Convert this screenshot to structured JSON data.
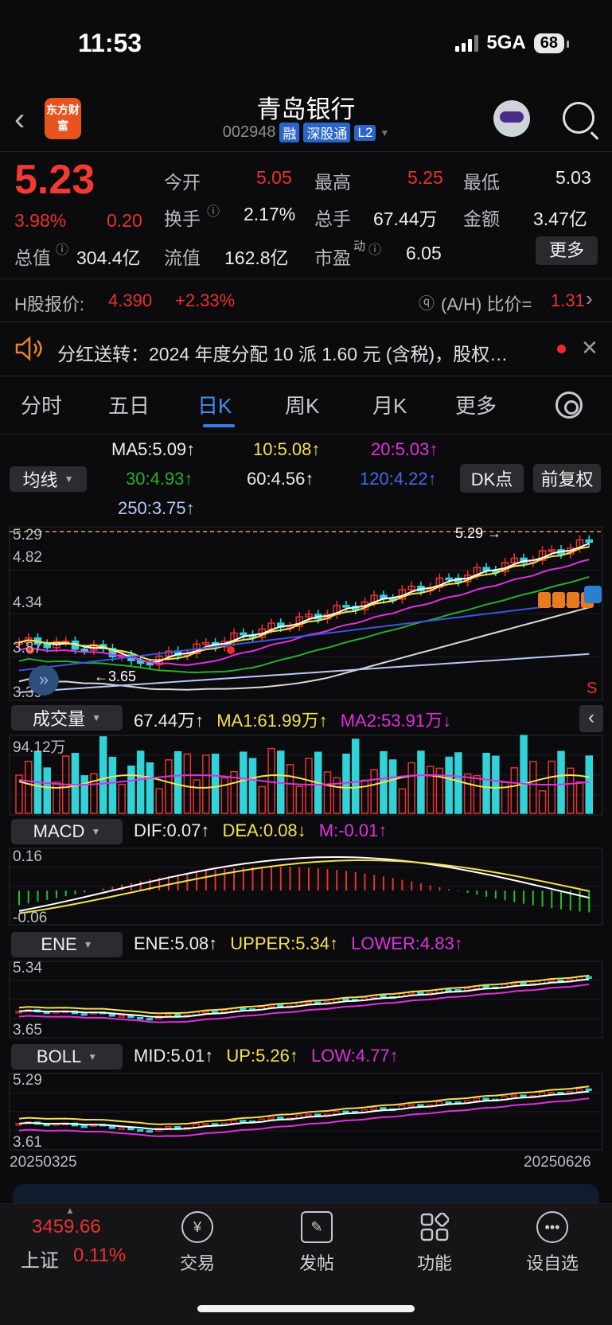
{
  "status": {
    "time": "11:53",
    "network": "5GA",
    "battery": "68"
  },
  "header": {
    "logo_text": "东方财富",
    "stock_name": "青岛银行",
    "stock_code": "002948",
    "tags": [
      "融",
      "深股通",
      "L2"
    ]
  },
  "quote": {
    "price": "5.23",
    "change_pct": "3.98%",
    "change": "0.20",
    "open_label": "今开",
    "open": "5.05",
    "high_label": "最高",
    "high": "5.25",
    "low_label": "最低",
    "low": "5.03",
    "turnover_label": "换手",
    "turnover": "2.17%",
    "volume_label": "总手",
    "volume": "67.44万",
    "amount_label": "金额",
    "amount": "3.47亿",
    "mktcap_label": "总值",
    "mktcap": "304.4亿",
    "float_label": "流值",
    "float": "162.8亿",
    "pe_label": "市盈",
    "pe_sup": "动",
    "pe": "6.05",
    "more": "更多"
  },
  "hshare": {
    "label": "H股报价:",
    "price": "4.390",
    "change": "+2.33%",
    "ratio_label": "(A/H) 比价=",
    "ratio": "1.31"
  },
  "notice": {
    "text": "分红送转：2024 年度分配 10 派 1.60 元 (含税)，股权…"
  },
  "tabs": [
    "分时",
    "五日",
    "日K",
    "周K",
    "月K",
    "更多"
  ],
  "active_tab": 2,
  "ma": {
    "selector": "均线",
    "ma5": "MA5:5.09",
    "ma10": "10:5.08",
    "ma20": "20:5.03",
    "ma30": "30:4.93",
    "ma60": "60:4.56",
    "ma120": "120:4.22",
    "ma250": "250:3.75",
    "dk": "DK点",
    "adjust": "前复权"
  },
  "kline": {
    "y_labels": [
      "5.29",
      "4.82",
      "4.34",
      "3.87",
      "3.39"
    ],
    "hi_mark": "5.29",
    "lo_mark": "3.65",
    "signal": "S"
  },
  "volume_panel": {
    "selector": "成交量",
    "vol": "67.44万",
    "ma1": "MA1:61.99万",
    "ma2": "MA2:53.91万",
    "max": "94.12万"
  },
  "macd_panel": {
    "selector": "MACD",
    "dif": "DIF:0.07",
    "dea": "DEA:0.08",
    "m": "M:-0.01",
    "top": "0.16",
    "bottom": "-0.06"
  },
  "ene_panel": {
    "selector": "ENE",
    "ene": "ENE:5.08",
    "upper": "UPPER:5.34",
    "lower": "LOWER:4.83",
    "top": "5.34",
    "bottom": "3.65"
  },
  "boll_panel": {
    "selector": "BOLL",
    "mid": "MID:5.01",
    "up": "UP:5.26",
    "low": "LOW:4.77",
    "top": "5.29",
    "bottom": "3.61"
  },
  "dates": {
    "start": "20250325",
    "end": "20250626"
  },
  "bottom_nav": {
    "index_value": "3459.66",
    "index_name": "上证",
    "index_change": "0.11%",
    "items": [
      "交易",
      "发帖",
      "功能",
      "设自选"
    ]
  },
  "colors": {
    "up": "#e8322f",
    "down": "#2fd3d8",
    "ma5": "#ffffff",
    "ma10": "#f5e050",
    "ma20": "#e030e0",
    "ma30": "#22b02a",
    "ma60": "#d8d8d8",
    "ma120": "#3b55e0",
    "ma250": "#b8c8f5"
  }
}
